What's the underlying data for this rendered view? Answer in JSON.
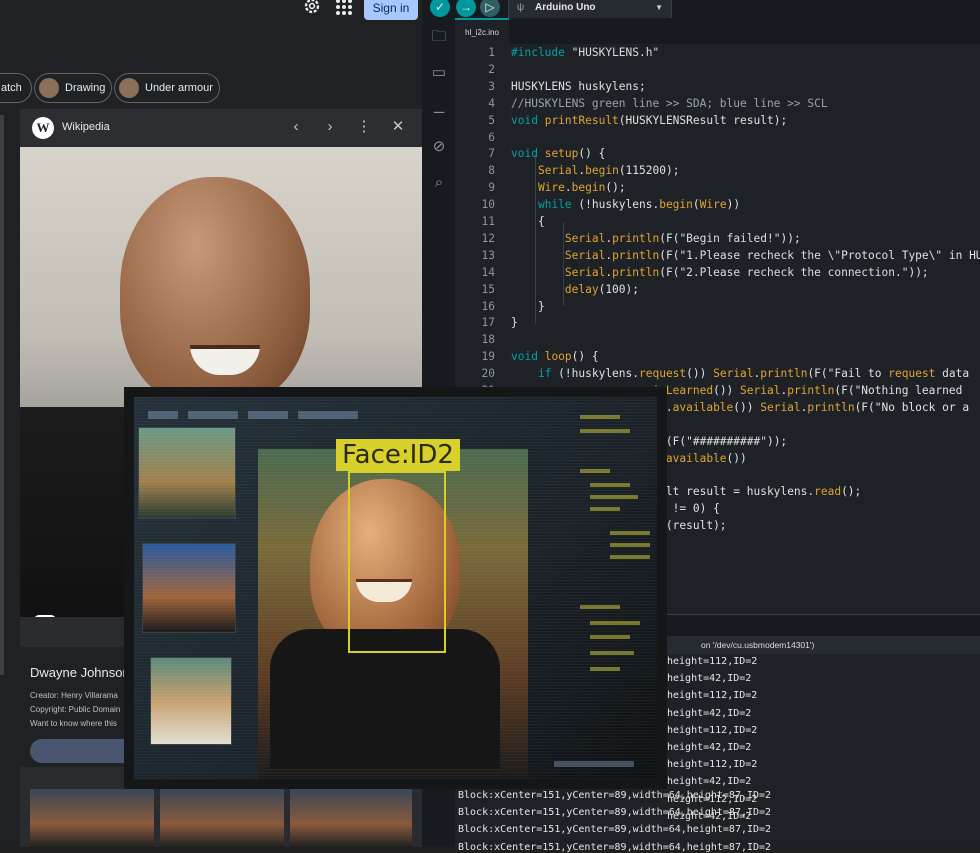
{
  "browser": {
    "signin_label": "Sign in",
    "chips": [
      {
        "label": "atch"
      },
      {
        "label": "Drawing"
      },
      {
        "label": "Under armour"
      }
    ],
    "card": {
      "source": "Wikipedia",
      "logo_letter": "W",
      "title": "Dwayne Johnson",
      "creator": "Creator: Henry Villarama",
      "copyright": "Copyright: Public Domain",
      "question": "Want to know where this"
    }
  },
  "ide": {
    "board": "Arduino Uno",
    "tab": "hl_i2c.ino",
    "serial_port": "on '/dev/cu.usbmodem14301')",
    "code_lines": [
      {
        "n": "1",
        "html": "#include \"HUSKYLENS.h\""
      },
      {
        "n": "2",
        "html": ""
      },
      {
        "n": "3",
        "html": "HUSKYLENS huskylens;"
      },
      {
        "n": "4",
        "html": "//HUSKYLENS green line >> SDA; blue line >> SCL"
      },
      {
        "n": "5",
        "html": "void printResult(HUSKYLENSResult result);"
      },
      {
        "n": "6",
        "html": ""
      },
      {
        "n": "7",
        "html": "void setup() {"
      },
      {
        "n": "8",
        "html": "    Serial.begin(115200);"
      },
      {
        "n": "9",
        "html": "    Wire.begin();"
      },
      {
        "n": "10",
        "html": "    while (!huskylens.begin(Wire))"
      },
      {
        "n": "11",
        "html": "    {"
      },
      {
        "n": "12",
        "html": "        Serial.println(F(\"Begin failed!\"));"
      },
      {
        "n": "13",
        "html": "        Serial.println(F(\"1.Please recheck the \\\"Protocol Type\\\" in HU"
      },
      {
        "n": "14",
        "html": "        Serial.println(F(\"2.Please recheck the connection.\"));"
      },
      {
        "n": "15",
        "html": "        delay(100);"
      },
      {
        "n": "16",
        "html": "    }"
      },
      {
        "n": "17",
        "html": "}"
      },
      {
        "n": "18",
        "html": ""
      },
      {
        "n": "19",
        "html": "void loop() {"
      },
      {
        "n": "20",
        "html": "    if (!huskylens.request()) Serial.println(F(\"Fail to request data"
      },
      {
        "n": "21",
        "html": "                     isLearned()) Serial.println(F(\"Nothing learned"
      },
      {
        "n": "22",
        "html": "                     ns.available()) Serial.println(F(\"No block or a"
      },
      {
        "n": "23",
        "html": ""
      },
      {
        "n": "24",
        "html": "                     ln(F(\"##########\"));"
      },
      {
        "n": "25",
        "html": "                     s.available())"
      },
      {
        "n": "26",
        "html": ""
      },
      {
        "n": "27",
        "html": "                     sult result = huskylens.read();"
      },
      {
        "n": "28",
        "html": "                     ID != 0) {"
      },
      {
        "n": "29",
        "html": "                     lt(result);"
      }
    ],
    "serial_lines": [
      "height=112,ID=2",
      "height=42,ID=2",
      "height=112,ID=2",
      "height=42,ID=2",
      "height=112,ID=2",
      "height=42,ID=2",
      "height=112,ID=2",
      "height=42,ID=2",
      "height=112,ID=2",
      "height=42,ID=2"
    ],
    "serial_full_lines": [
      "Block:xCenter=151,yCenter=89,width=64,height=87,ID=2",
      "Block:xCenter=151,yCenter=89,width=64,height=87,ID=2",
      "Block:xCenter=151,yCenter=89,width=64,height=87,ID=2",
      "Block:xCenter=151,yCenter=89,width=64,height=87,ID=2"
    ]
  },
  "overlay": {
    "label": "Face:ID2"
  }
}
